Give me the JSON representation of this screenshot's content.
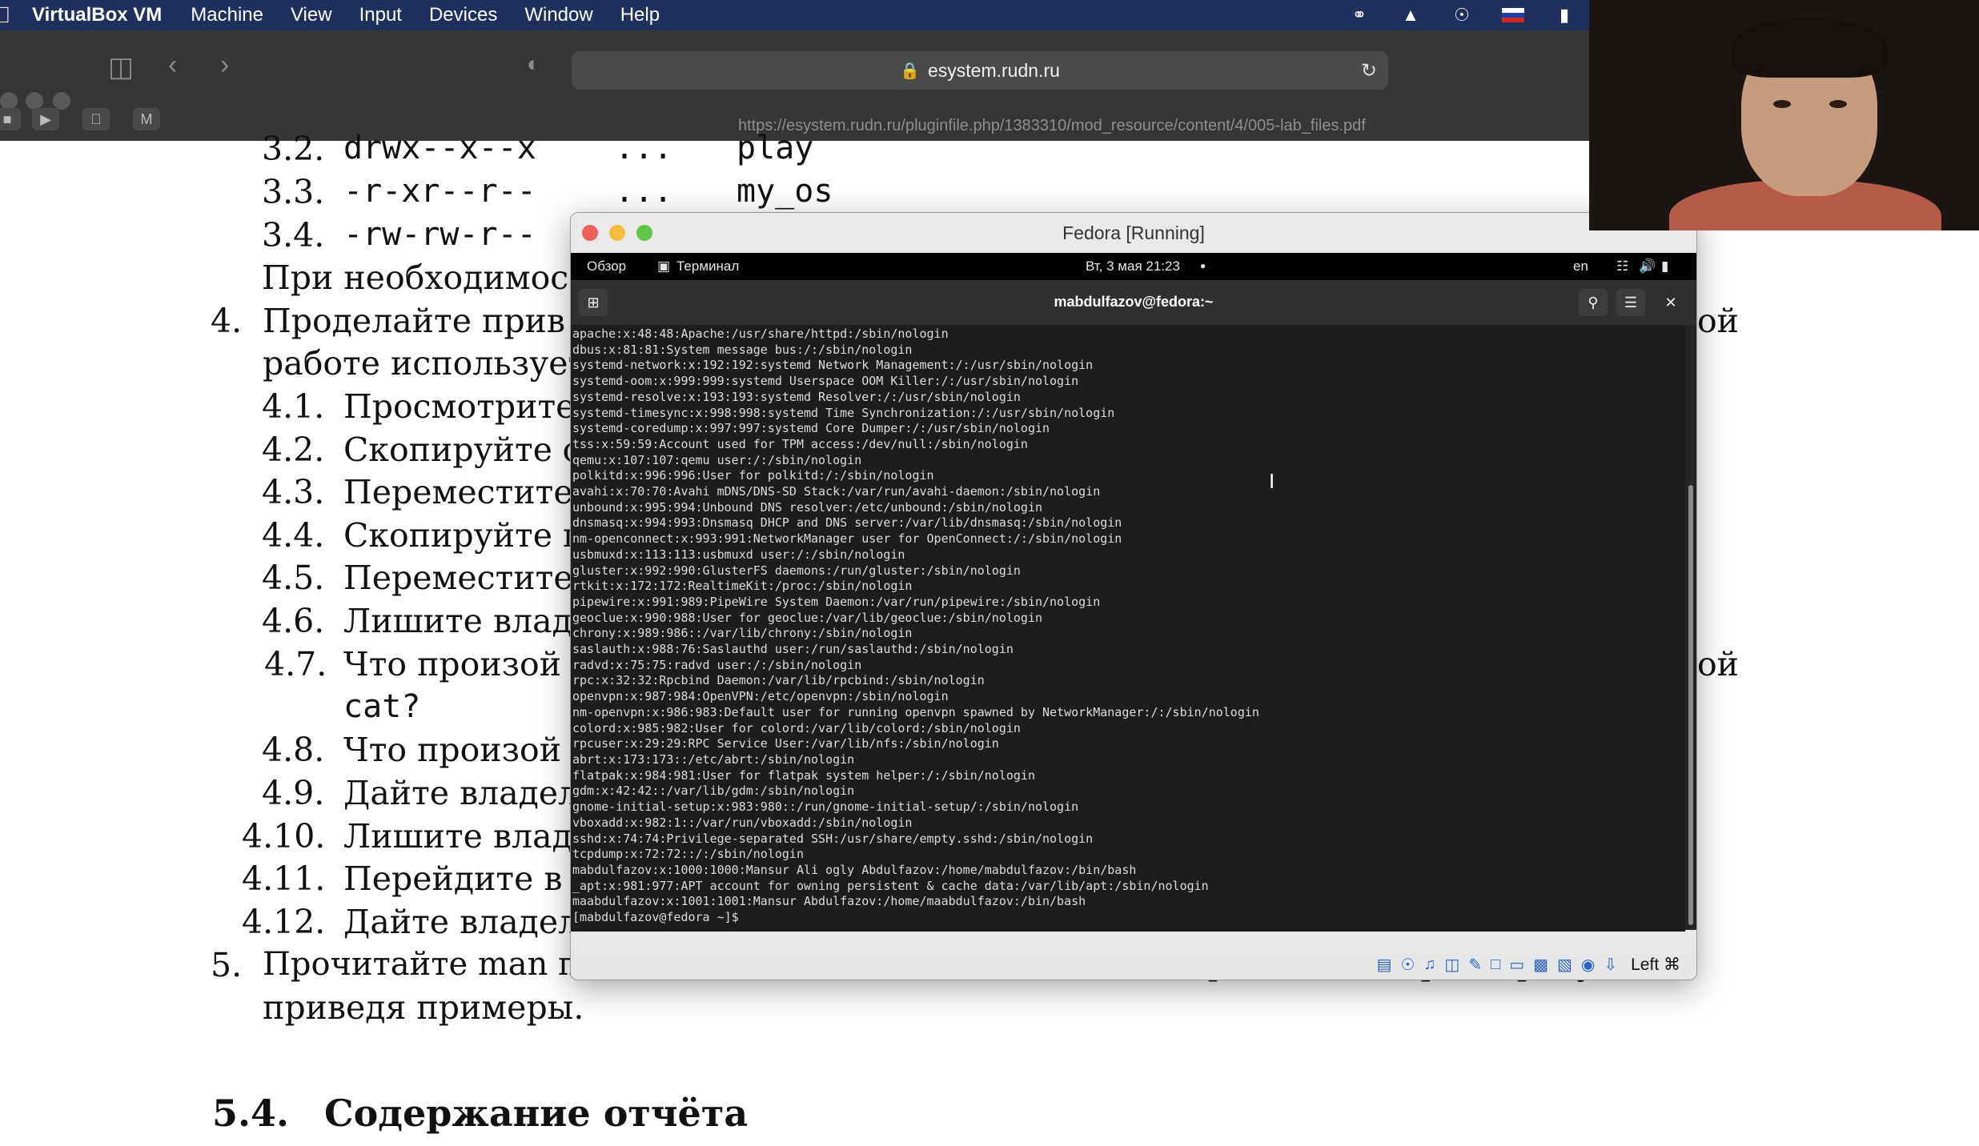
{
  "menubar": {
    "app_name": "VirtualBox VM",
    "items": [
      "Machine",
      "View",
      "Input",
      "Devices",
      "Window",
      "Help"
    ]
  },
  "browser": {
    "url": "esystem.rudn.ru",
    "pdf_url": "https://esystem.rudn.ru/pluginfile.php/1383310/mod_resource/content/4/005-lab_files.pdf"
  },
  "document": {
    "lines": [
      {
        "num": "3.2.",
        "text": "drwx--x--x",
        "dots": "...",
        "name": "play"
      },
      {
        "num": "3.3.",
        "text": "-r-xr--r--",
        "dots": "...",
        "name": "my_os"
      },
      {
        "num": "3.4.",
        "text": "-rw-rw-r--"
      }
    ],
    "if_needed": "При необходимос",
    "item4": {
      "num": "4.",
      "line1": "Проделайте прив",
      "line1_end": "ой",
      "line2": "работе использует"
    },
    "sub4": [
      {
        "num": "4.1.",
        "text": "Просмотрите"
      },
      {
        "num": "4.2.",
        "text": "Скопируйте ф"
      },
      {
        "num": "4.3.",
        "text": "Переместите"
      },
      {
        "num": "4.4.",
        "text": "Скопируйте п"
      },
      {
        "num": "4.5.",
        "text": "Переместите"
      },
      {
        "num": "4.6.",
        "text": "Лишите влад"
      },
      {
        "num": "4.7.",
        "text": "Что произой",
        "end": "ой",
        "cont": "cat?"
      },
      {
        "num": "4.8.",
        "text": "Что произой"
      },
      {
        "num": "4.9.",
        "text": "Дайте владел"
      },
      {
        "num": "4.10.",
        "text": "Лишите влад"
      },
      {
        "num": "4.11.",
        "text": "Перейдите в"
      },
      {
        "num": "4.12.",
        "text": "Дайте владел"
      }
    ],
    "item5": {
      "num": "5.",
      "line1": "Прочитайте man по командам mount, fsck, mkfs, kill и кратко их охарактеризуйте,",
      "line2": "приведя примеры."
    },
    "section": {
      "num": "5.4.",
      "title": "Содержание отчёта"
    }
  },
  "vm_window": {
    "title": "Fedora [Running]",
    "gnome": {
      "overview": "Обзор",
      "terminal": "Терминал",
      "datetime": "Вт, 3 мая  21:23",
      "lang": "en"
    },
    "terminal_title": "mabdulfazov@fedora:~",
    "status_hostkey": "Left ⌘"
  },
  "terminal_lines": [
    "apache:x:48:48:Apache:/usr/share/httpd:/sbin/nologin",
    "dbus:x:81:81:System message bus:/:/sbin/nologin",
    "systemd-network:x:192:192:systemd Network Management:/:/usr/sbin/nologin",
    "systemd-oom:x:999:999:systemd Userspace OOM Killer:/:/usr/sbin/nologin",
    "systemd-resolve:x:193:193:systemd Resolver:/:/usr/sbin/nologin",
    "systemd-timesync:x:998:998:systemd Time Synchronization:/:/usr/sbin/nologin",
    "systemd-coredump:x:997:997:systemd Core Dumper:/:/usr/sbin/nologin",
    "tss:x:59:59:Account used for TPM access:/dev/null:/sbin/nologin",
    "qemu:x:107:107:qemu user:/:/sbin/nologin",
    "polkitd:x:996:996:User for polkitd:/:/sbin/nologin",
    "avahi:x:70:70:Avahi mDNS/DNS-SD Stack:/var/run/avahi-daemon:/sbin/nologin",
    "unbound:x:995:994:Unbound DNS resolver:/etc/unbound:/sbin/nologin",
    "dnsmasq:x:994:993:Dnsmasq DHCP and DNS server:/var/lib/dnsmasq:/sbin/nologin",
    "nm-openconnect:x:993:991:NetworkManager user for OpenConnect:/:/sbin/nologin",
    "usbmuxd:x:113:113:usbmuxd user:/:/sbin/nologin",
    "gluster:x:992:990:GlusterFS daemons:/run/gluster:/sbin/nologin",
    "rtkit:x:172:172:RealtimeKit:/proc:/sbin/nologin",
    "pipewire:x:991:989:PipeWire System Daemon:/var/run/pipewire:/sbin/nologin",
    "geoclue:x:990:988:User for geoclue:/var/lib/geoclue:/sbin/nologin",
    "chrony:x:989:986::/var/lib/chrony:/sbin/nologin",
    "saslauth:x:988:76:Saslauthd user:/run/saslauthd:/sbin/nologin",
    "radvd:x:75:75:radvd user:/:/sbin/nologin",
    "rpc:x:32:32:Rpcbind Daemon:/var/lib/rpcbind:/sbin/nologin",
    "openvpn:x:987:984:OpenVPN:/etc/openvpn:/sbin/nologin",
    "nm-openvpn:x:986:983:Default user for running openvpn spawned by NetworkManager:/:/sbin/nologin",
    "colord:x:985:982:User for colord:/var/lib/colord:/sbin/nologin",
    "rpcuser:x:29:29:RPC Service User:/var/lib/nfs:/sbin/nologin",
    "abrt:x:173:173::/etc/abrt:/sbin/nologin",
    "flatpak:x:984:981:User for flatpak system helper:/:/sbin/nologin",
    "gdm:x:42:42::/var/lib/gdm:/sbin/nologin",
    "gnome-initial-setup:x:983:980::/run/gnome-initial-setup/:/sbin/nologin",
    "vboxadd:x:982:1::/var/run/vboxadd:/sbin/nologin",
    "sshd:x:74:74:Privilege-separated SSH:/usr/share/empty.sshd:/sbin/nologin",
    "tcpdump:x:72:72::/:/sbin/nologin",
    "mabdulfazov:x:1000:1000:Mansur Ali ogly Abdulfazov:/home/mabdulfazov:/bin/bash",
    "_apt:x:981:977:APT account for owning persistent & cache data:/var/lib/apt:/sbin/nologin",
    "maabdulfazov:x:1001:1001:Mansur Abdulfazov:/home/maabdulfazov:/bin/bash",
    "[mabdulfazov@fedora ~]$ "
  ],
  "colors": {
    "menubar": "#1f2f5e",
    "toolbar": "#363636",
    "terminal_bg": "#1d1d1d"
  }
}
